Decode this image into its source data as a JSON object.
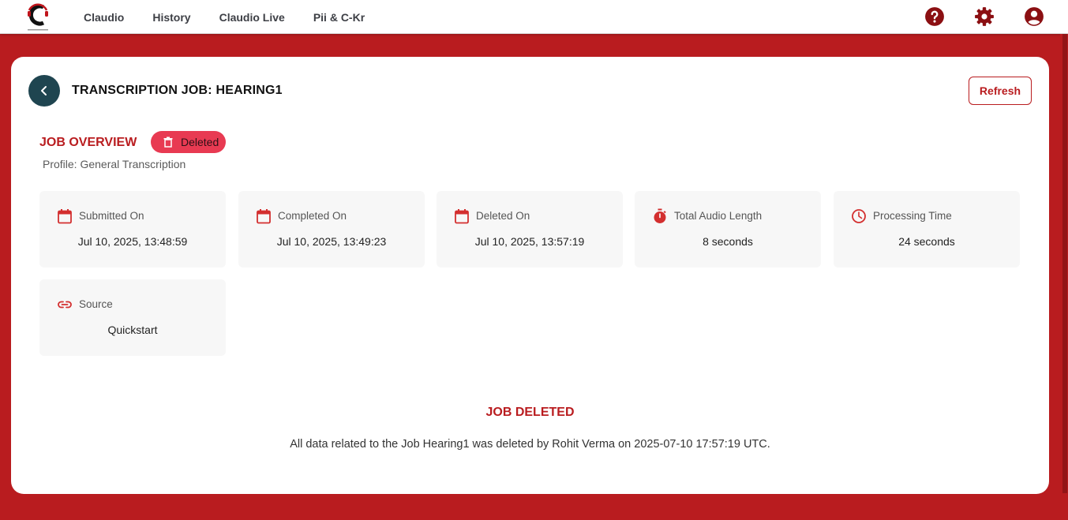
{
  "nav": {
    "items": [
      "Claudio",
      "History",
      "Claudio Live",
      "Pii & C-Kr"
    ]
  },
  "topbar": {
    "icons": [
      "help-icon",
      "settings-icon",
      "account-icon"
    ],
    "icon_color": "#8b0f12"
  },
  "header": {
    "title": "TRANSCRIPTION JOB: HEARING1",
    "refresh_label": "Refresh"
  },
  "overview": {
    "title": "JOB OVERVIEW",
    "status_badge": "Deleted",
    "profile": "Profile: General Transcription"
  },
  "stats": [
    {
      "icon": "calendar-icon",
      "label": "Submitted On",
      "value": "Jul 10, 2025, 13:48:59"
    },
    {
      "icon": "calendar-icon",
      "label": "Completed On",
      "value": "Jul 10, 2025, 13:49:23"
    },
    {
      "icon": "calendar-icon",
      "label": "Deleted On",
      "value": "Jul 10, 2025, 13:57:19"
    },
    {
      "icon": "timer-icon",
      "label": "Total Audio Length",
      "value": "8 seconds"
    },
    {
      "icon": "clock-icon",
      "label": "Processing Time",
      "value": "24 seconds"
    },
    {
      "icon": "link-icon",
      "label": "Source",
      "value": "Quickstart"
    }
  ],
  "deleted_notice": {
    "title": "JOB DELETED",
    "message": "All data related to the Job Hearing1 was deleted by Rohit Verma on 2025-07-10 17:57:19 UTC."
  },
  "colors": {
    "brand_red": "#b91c1f",
    "badge_red": "#e83a52",
    "back_button": "#1f4550",
    "icon_red": "#d32f2f"
  }
}
